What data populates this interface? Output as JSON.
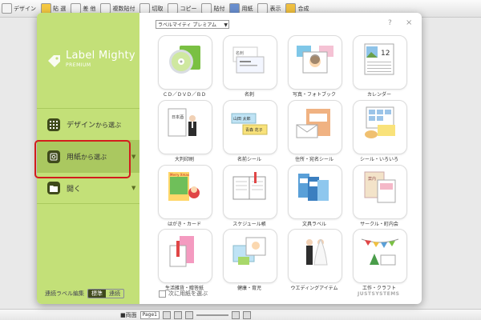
{
  "toolbar": {
    "items": [
      "デザイン",
      "貼 選",
      "差 他",
      "複数貼付",
      "切取",
      "コピー",
      "貼付",
      "用紙",
      "表示",
      "合成"
    ]
  },
  "statusbar": {
    "view": "■両面",
    "page": "Page1"
  },
  "dialog": {
    "dropdown": "ラベルマイティ プレミアム",
    "help": "?",
    "close": "×",
    "logo": "Label Mighty",
    "logo_sub": "PREMIUM",
    "nav": [
      {
        "label": "デザイン",
        "small": "から選ぶ"
      },
      {
        "label": "用紙",
        "small": "から選ぶ"
      },
      {
        "label": "開く",
        "small": ""
      }
    ],
    "side_footer": {
      "label": "連続ラベル編集",
      "on": "標準",
      "off": "連続"
    },
    "categories": [
      "ＣＤ／ＤＶＤ／ＢＤ",
      "名刺",
      "写真・フォトブック",
      "カレンダー",
      "大判印刷",
      "名前シール",
      "住所・宛名シール",
      "シール・いろいろ",
      "はがき・カード",
      "スケジュール帳",
      "文具ラベル",
      "サークル・町内会",
      "生活雑貨・贈答紙",
      "健康・育児",
      "ウエディングアイテム",
      "工作・クラフト"
    ],
    "checkbox_label": "次に用紙を選ぶ",
    "brand": "JUSTSYSTEMS",
    "thumb_text": {
      "meishi": "名刺",
      "calendar": "12",
      "poster": "日本酒",
      "name_tag": "山田 太郎",
      "name_tag2": "青森 花子",
      "card": "Merry Xmas",
      "circle": "案内"
    }
  }
}
